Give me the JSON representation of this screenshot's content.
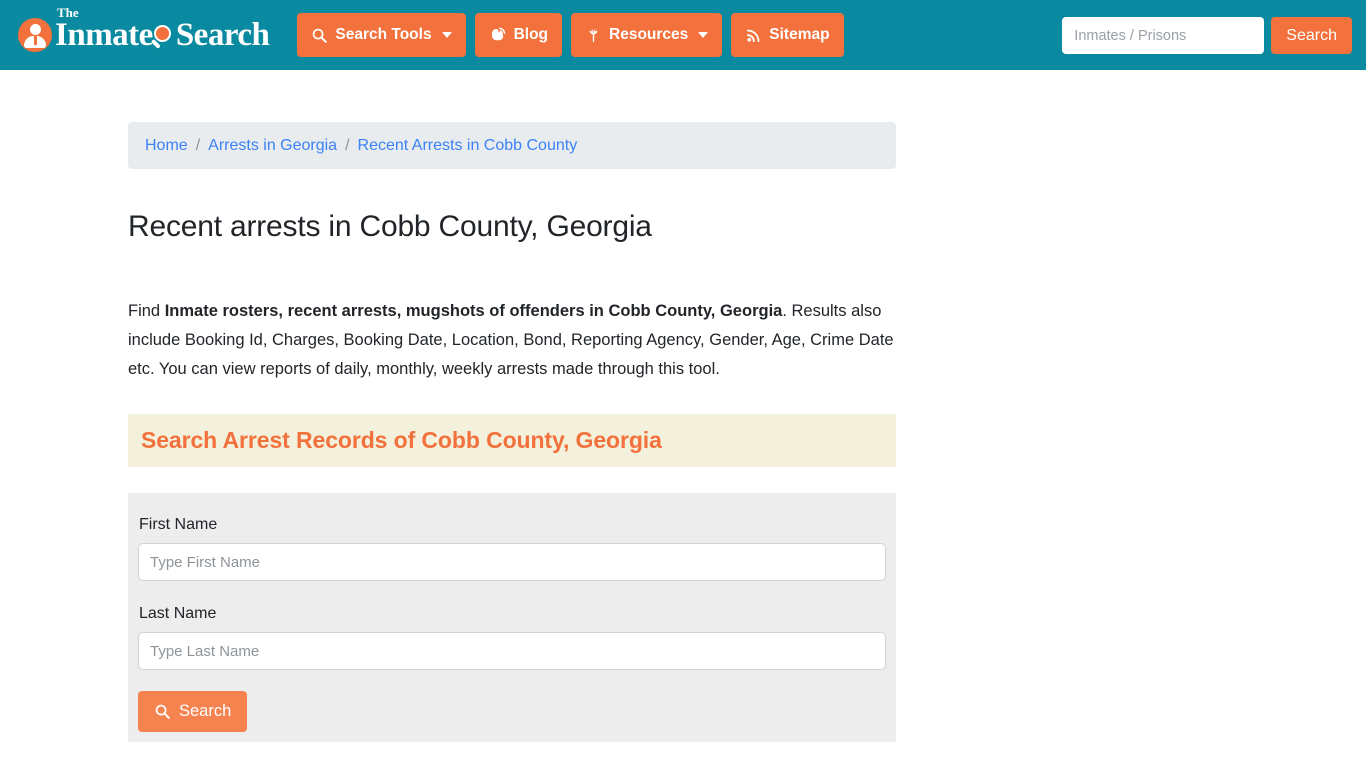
{
  "header": {
    "logo": {
      "prefix": "The",
      "word_one": "Inmate",
      "word_two": "Search",
      "badge_icon": "person-badge-icon",
      "glass_icon": "magnifier-icon"
    },
    "nav": [
      {
        "label": "Search Tools",
        "icon": "magnifier-icon",
        "caret": true
      },
      {
        "label": "Blog",
        "icon": "blogger-icon",
        "caret": false
      },
      {
        "label": "Resources",
        "icon": "leaf-icon",
        "caret": true
      },
      {
        "label": "Sitemap",
        "icon": "rss-icon",
        "caret": false
      }
    ],
    "search": {
      "placeholder": "Inmates / Prisons",
      "value": "",
      "button_label": "Search"
    }
  },
  "breadcrumb": {
    "items": [
      {
        "label": "Home"
      },
      {
        "label": "Arrests in Georgia"
      },
      {
        "label": "Recent Arrests in Cobb County"
      }
    ],
    "separator": "/"
  },
  "main": {
    "page_title": "Recent arrests in Cobb County, Georgia",
    "intro": {
      "lead": "Find ",
      "bold": "Inmate rosters, recent arrests, mugshots of offenders in Cobb County, Georgia",
      "rest": ". Results also include Booking Id, Charges, Booking Date, Location, Bond, Reporting Agency, Gender, Age, Crime Date etc. You can view reports of daily, monthly, weekly arrests made through this tool."
    },
    "section_heading": "Search Arrest Records of Cobb County, Georgia",
    "form": {
      "first_name": {
        "label": "First Name",
        "placeholder": "Type First Name",
        "value": ""
      },
      "last_name": {
        "label": "Last Name",
        "placeholder": "Type Last Name",
        "value": ""
      },
      "submit_label": "Search",
      "submit_icon": "magnifier-icon"
    }
  },
  "colors": {
    "header_teal": "#0a8aa0",
    "accent_orange": "#f2713c",
    "breadcrumb_bg": "#e9ecef",
    "section_bg": "#f3f1db",
    "form_bg": "#ededed",
    "link_blue": "#3b82f6"
  }
}
